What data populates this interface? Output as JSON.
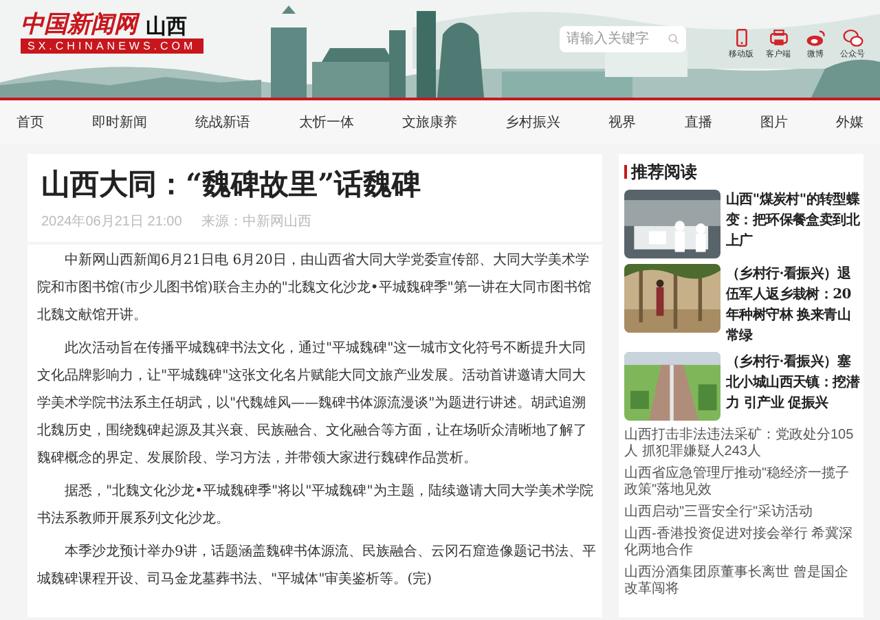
{
  "site": {
    "logo": "中国新闻网",
    "region": "山西",
    "domain": "SX.CHINANEWS.COM"
  },
  "search": {
    "placeholder": "请输入关键字"
  },
  "header_links": [
    {
      "label": "移动版",
      "kind": "phone"
    },
    {
      "label": "客户端",
      "kind": "client"
    },
    {
      "label": "微博",
      "kind": "weibo"
    },
    {
      "label": "公众号",
      "kind": "wechat"
    }
  ],
  "nav": [
    {
      "label": "首页"
    },
    {
      "label": "即时新闻"
    },
    {
      "label": "统战新语"
    },
    {
      "label": "太忻一体"
    },
    {
      "label": "文旅康养"
    },
    {
      "label": "乡村振兴"
    },
    {
      "label": "视界"
    },
    {
      "label": "直播"
    },
    {
      "label": "图片"
    },
    {
      "label": "外媒"
    }
  ],
  "article": {
    "title": "山西大同：“魏碑故里”话魏碑",
    "date": "2024年06月21日 21:00",
    "source": "来源：中新网山西",
    "paragraphs": [
      "中新网山西新闻6月21日电 6月20日，由山西省大同大学党委宣传部、大同大学美术学院和市图书馆(市少儿图书馆)联合主办的\"北魏文化沙龙•平城魏碑季\"第一讲在大同市图书馆北魏文献馆开讲。",
      "此次活动旨在传播平城魏碑书法文化，通过\"平城魏碑\"这一城市文化符号不断提升大同文化品牌影响力，让\"平城魏碑\"这张文化名片赋能大同文旅产业发展。活动首讲邀请大同大学美术学院书法系主任胡武，以\"代魏雄风——魏碑书体源流漫谈\"为题进行讲述。胡武追溯北魏历史，围绕魏碑起源及其兴衰、民族融合、文化融合等方面，让在场听众清晰地了解了魏碑概念的界定、发展阶段、学习方法，并带领大家进行魏碑作品赏析。",
      "据悉，\"北魏文化沙龙•平城魏碑季\"将以\"平城魏碑\"为主题，陆续邀请大同大学美术学院书法系教师开展系列文化沙龙。",
      "本季沙龙预计举办9讲，话题涵盖魏碑书体源流、民族融合、云冈石窟造像题记书法、平城魏碑课程开设、司马金龙墓葬书法、\"平城体\"审美鉴析等。(完)"
    ]
  },
  "sidebar": {
    "title": "推荐阅读",
    "featured": [
      {
        "title": "山西\"煤炭村\"的转型蝶变：把环保餐盒卖到北上广",
        "kind": "picture"
      },
      {
        "title": "（乡村行·看振兴）退伍军人返乡栽树：20年种树守林 换来青山常绿",
        "kind": "picture"
      },
      {
        "title": "（乡村行·看振兴）塞北小城山西天镇：挖潜力 引产业 促振兴",
        "kind": "picture"
      }
    ],
    "links": [
      "山西打击非法违法采矿：党政处分105人 抓犯罪嫌疑人243人",
      "山西省应急管理厅推动\"稳经济一揽子政策\"落地见效",
      "山西启动\"三晋安全行\"采访活动",
      "山西-香港投资促进对接会举行 希冀深化两地合作",
      "山西汾酒集团原董事长离世 曾是国企改革闯将"
    ]
  }
}
